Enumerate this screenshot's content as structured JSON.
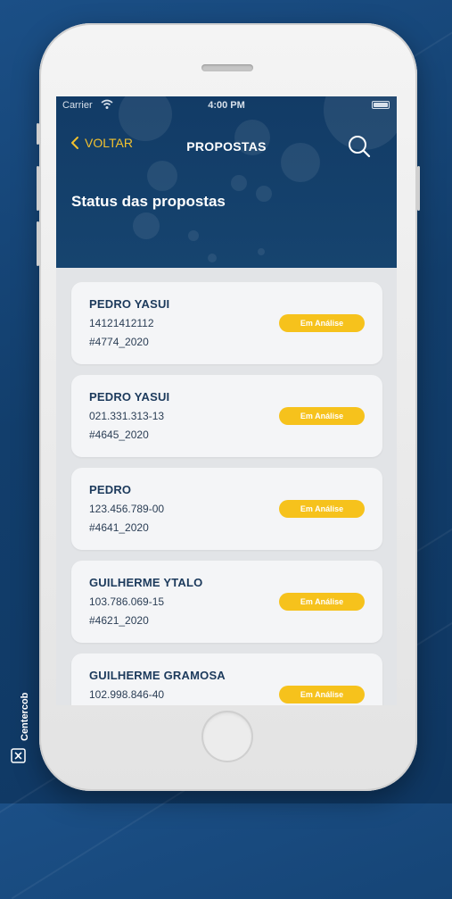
{
  "status_bar": {
    "carrier": "Carrier",
    "time": "4:00 PM"
  },
  "header": {
    "back_label": "VOLTAR",
    "title": "PROPOSTAS",
    "page_title": "Status das propostas",
    "icons": {
      "back": "chevron-left-icon",
      "search": "search-icon"
    }
  },
  "proposals": [
    {
      "name": "PEDRO YASUI",
      "document": "14121412112",
      "code": "#4774_2020",
      "status": "Em Análise"
    },
    {
      "name": "PEDRO YASUI",
      "document": "021.331.313-13",
      "code": "#4645_2020",
      "status": "Em Análise"
    },
    {
      "name": "PEDRO",
      "document": "123.456.789-00",
      "code": "#4641_2020",
      "status": "Em Análise"
    },
    {
      "name": "GUILHERME YTALO",
      "document": "103.786.069-15",
      "code": "#4621_2020",
      "status": "Em Análise"
    },
    {
      "name": "GUILHERME GRAMOSA",
      "document": "102.998.846-40",
      "code": "",
      "status": "Em Análise"
    }
  ],
  "brand": {
    "name": "Centercob"
  },
  "colors": {
    "header": "#16446f",
    "accent": "#f2c12e",
    "badge": "#f6c21c",
    "card": "#f4f5f7"
  }
}
